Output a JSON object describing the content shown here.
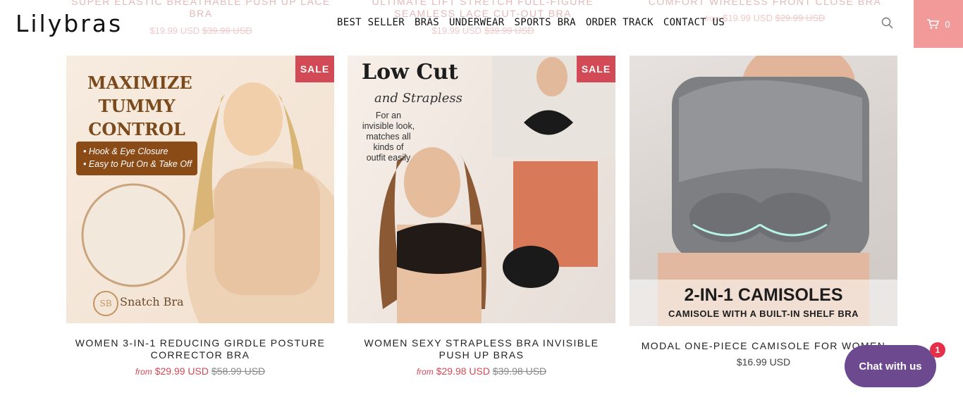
{
  "header": {
    "logo": "Lilybras",
    "nav": [
      "BEST SELLER",
      "BRAS",
      "UNDERWEAR",
      "SPORTS BRA",
      "ORDER TRACK",
      "CONTACT US"
    ],
    "cart_count": "0"
  },
  "ghost": {
    "titles": [
      "SUPER ELASTIC BREATHABLE PUSH UP LACE BRA",
      "ULTIMATE LIFT STRETCH FULL-FIGURE SEAMLESS LACE CUT-OUT BRA",
      "COMFORT WIRELESS FRONT CLOSE BRA"
    ],
    "prices": [
      {
        "current": "$19.99 USD",
        "old": "$39.99 USD"
      },
      {
        "current": "$19.99 USD",
        "old": "$39.99 USD"
      },
      {
        "from": "from",
        "current": "$19.99 USD",
        "old": "$29.99 USD"
      }
    ]
  },
  "products": [
    {
      "sale": "SALE",
      "title": "WOMEN 3-IN-1 REDUCING GIRDLE POSTURE CORRECTOR BRA",
      "from": "from",
      "price": "$29.99 USD",
      "old_price": "$58.99 USD",
      "image_text": {
        "headline": [
          "MAXIMIZE",
          "TUMMY",
          "CONTROL"
        ],
        "bullets": [
          "• Hook & Eye Closure",
          "• Easy to Put On & Take Off"
        ],
        "brand": "Snatch Bra",
        "logo": "SB"
      }
    },
    {
      "sale": "SALE",
      "title": "WOMEN SEXY STRAPLESS BRA INVISIBLE PUSH UP BRAS",
      "from": "from",
      "price": "$29.98 USD",
      "old_price": "$39.98 USD",
      "image_text": {
        "headline": "Low Cut",
        "script": "and Strapless",
        "caption": [
          "For an",
          "invisible look,",
          "matches all",
          "kinds of",
          "outfit easily"
        ]
      }
    },
    {
      "title": "MODAL ONE-PIECE CAMISOLE FOR WOMEN",
      "price": "$16.99 USD",
      "image_text": {
        "headline": "2-IN-1 CAMISOLES",
        "sub": "CAMISOLE WITH A BUILT-IN SHELF BRA"
      }
    }
  ],
  "chat": {
    "label": "Chat with us",
    "badge": "1"
  },
  "colors": {
    "accent": "#d24a55",
    "cart_bg": "#f29a9a",
    "chat_bg": "#6d4a8f"
  }
}
